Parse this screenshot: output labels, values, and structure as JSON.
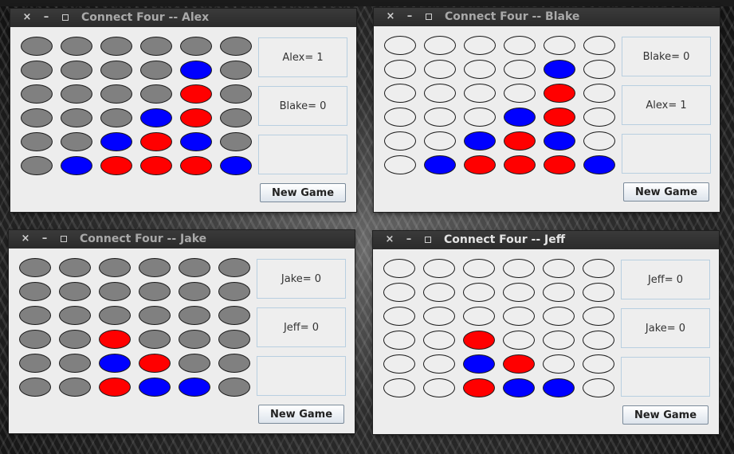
{
  "windows": [
    {
      "title": "Connect Four -- Alex",
      "active": false,
      "empty_color": "grey",
      "board": [
        [
          "e",
          "e",
          "e",
          "e",
          "e",
          "e"
        ],
        [
          "e",
          "e",
          "e",
          "e",
          "b",
          "e"
        ],
        [
          "e",
          "e",
          "e",
          "e",
          "r",
          "e"
        ],
        [
          "e",
          "e",
          "e",
          "b",
          "r",
          "e"
        ],
        [
          "e",
          "e",
          "b",
          "r",
          "b",
          "e"
        ],
        [
          "e",
          "b",
          "r",
          "r",
          "r",
          "b"
        ]
      ],
      "score_top": "Alex= 1",
      "score_bottom": "Blake= 0",
      "status": "",
      "button_label": "New Game"
    },
    {
      "title": "Connect Four -- Blake",
      "active": false,
      "empty_color": "white",
      "board": [
        [
          "e",
          "e",
          "e",
          "e",
          "e",
          "e"
        ],
        [
          "e",
          "e",
          "e",
          "e",
          "b",
          "e"
        ],
        [
          "e",
          "e",
          "e",
          "e",
          "r",
          "e"
        ],
        [
          "e",
          "e",
          "e",
          "b",
          "r",
          "e"
        ],
        [
          "e",
          "e",
          "b",
          "r",
          "b",
          "e"
        ],
        [
          "e",
          "b",
          "r",
          "r",
          "r",
          "b"
        ]
      ],
      "score_top": "Blake= 0",
      "score_bottom": "Alex= 1",
      "status": "",
      "button_label": "New Game"
    },
    {
      "title": "Connect Four -- Jake",
      "active": false,
      "empty_color": "grey",
      "board": [
        [
          "e",
          "e",
          "e",
          "e",
          "e",
          "e"
        ],
        [
          "e",
          "e",
          "e",
          "e",
          "e",
          "e"
        ],
        [
          "e",
          "e",
          "e",
          "e",
          "e",
          "e"
        ],
        [
          "e",
          "e",
          "r",
          "e",
          "e",
          "e"
        ],
        [
          "e",
          "e",
          "b",
          "r",
          "e",
          "e"
        ],
        [
          "e",
          "e",
          "r",
          "b",
          "b",
          "e"
        ]
      ],
      "score_top": "Jake= 0",
      "score_bottom": "Jeff= 0",
      "status": "",
      "button_label": "New Game"
    },
    {
      "title": "Connect Four -- Jeff",
      "active": true,
      "empty_color": "white",
      "board": [
        [
          "e",
          "e",
          "e",
          "e",
          "e",
          "e"
        ],
        [
          "e",
          "e",
          "e",
          "e",
          "e",
          "e"
        ],
        [
          "e",
          "e",
          "e",
          "e",
          "e",
          "e"
        ],
        [
          "e",
          "e",
          "r",
          "e",
          "e",
          "e"
        ],
        [
          "e",
          "e",
          "b",
          "r",
          "e",
          "e"
        ],
        [
          "e",
          "e",
          "r",
          "b",
          "b",
          "e"
        ]
      ],
      "score_top": "Jeff= 0",
      "score_bottom": "Jake= 0",
      "status": "",
      "button_label": "New Game"
    }
  ],
  "titlebar_icons": {
    "close": "×",
    "minimize": "–"
  },
  "colors": {
    "red_piece": "#ff0000",
    "blue_piece": "#0000ff",
    "grey_empty": "#808080",
    "white_empty": "#eeeeee"
  }
}
